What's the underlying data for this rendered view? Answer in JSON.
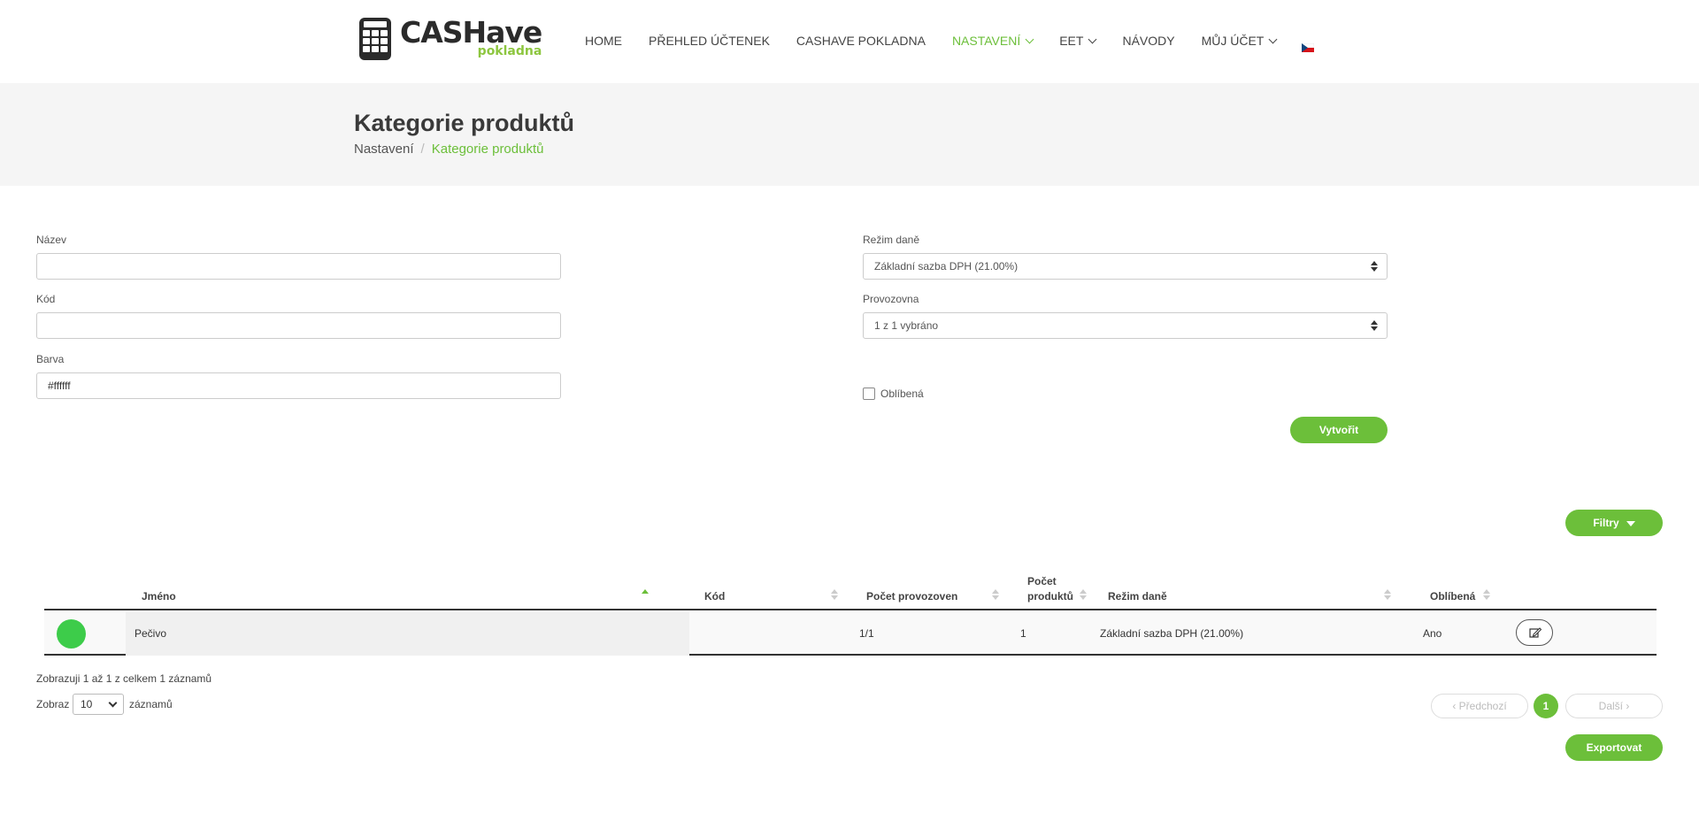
{
  "brand": {
    "name": "CASHave",
    "sub": "pokladna"
  },
  "nav": {
    "items": [
      {
        "label": "HOME",
        "active": false,
        "dropdown": false
      },
      {
        "label": "PŘEHLED ÚČTENEK",
        "active": false,
        "dropdown": false
      },
      {
        "label": "CASHAVE POKLADNA",
        "active": false,
        "dropdown": false
      },
      {
        "label": "NASTAVENÍ",
        "active": true,
        "dropdown": true
      },
      {
        "label": "EET",
        "active": false,
        "dropdown": true
      },
      {
        "label": "NÁVODY",
        "active": false,
        "dropdown": false
      },
      {
        "label": "MŮJ ÚČET",
        "active": false,
        "dropdown": true
      }
    ],
    "language_icon": "czech-flag-icon"
  },
  "page": {
    "title": "Kategorie produktů",
    "breadcrumb": {
      "parent": "Nastavení",
      "separator": "/",
      "current": "Kategorie produktů"
    }
  },
  "form": {
    "name_label": "Název",
    "name_value": "",
    "code_label": "Kód",
    "code_value": "",
    "color_label": "Barva",
    "color_value": "#ffffff",
    "tax_label": "Režim daně",
    "tax_value": "Základní sazba DPH (21.00%)",
    "branch_label": "Provozovna",
    "branch_value": "1 z 1 vybráno",
    "favorite_label": "Oblíbená",
    "favorite_checked": false,
    "create_button": "Vytvořit"
  },
  "filters_button": "Filtry",
  "table": {
    "columns": {
      "name": "Jméno",
      "code": "Kód",
      "branch_count": "Počet provozoven",
      "product_count_line1": "Počet",
      "product_count_line2": "produktů",
      "tax": "Režim daně",
      "favorite": "Oblíbená"
    },
    "rows": [
      {
        "color": "#3dcc4a",
        "name": "Pečivo",
        "code": "",
        "branch_count": "1/1",
        "product_count": "1",
        "tax": "Základní sazba DPH (21.00%)",
        "favorite": "Ano",
        "edit_icon": "edit-icon"
      }
    ],
    "info": "Zobrazuji 1 až 1 z celkem 1 záznamů",
    "length_prefix": "Zobraz",
    "length_value": "10",
    "length_suffix": "záznamů"
  },
  "pagination": {
    "prev": "‹ Předchozí",
    "current": "1",
    "next": "Další ›"
  },
  "export_button": "Exportovat",
  "colors": {
    "accent": "#6cbf3a",
    "dark": "#2b2b2b",
    "band": "#f5f5f5"
  }
}
